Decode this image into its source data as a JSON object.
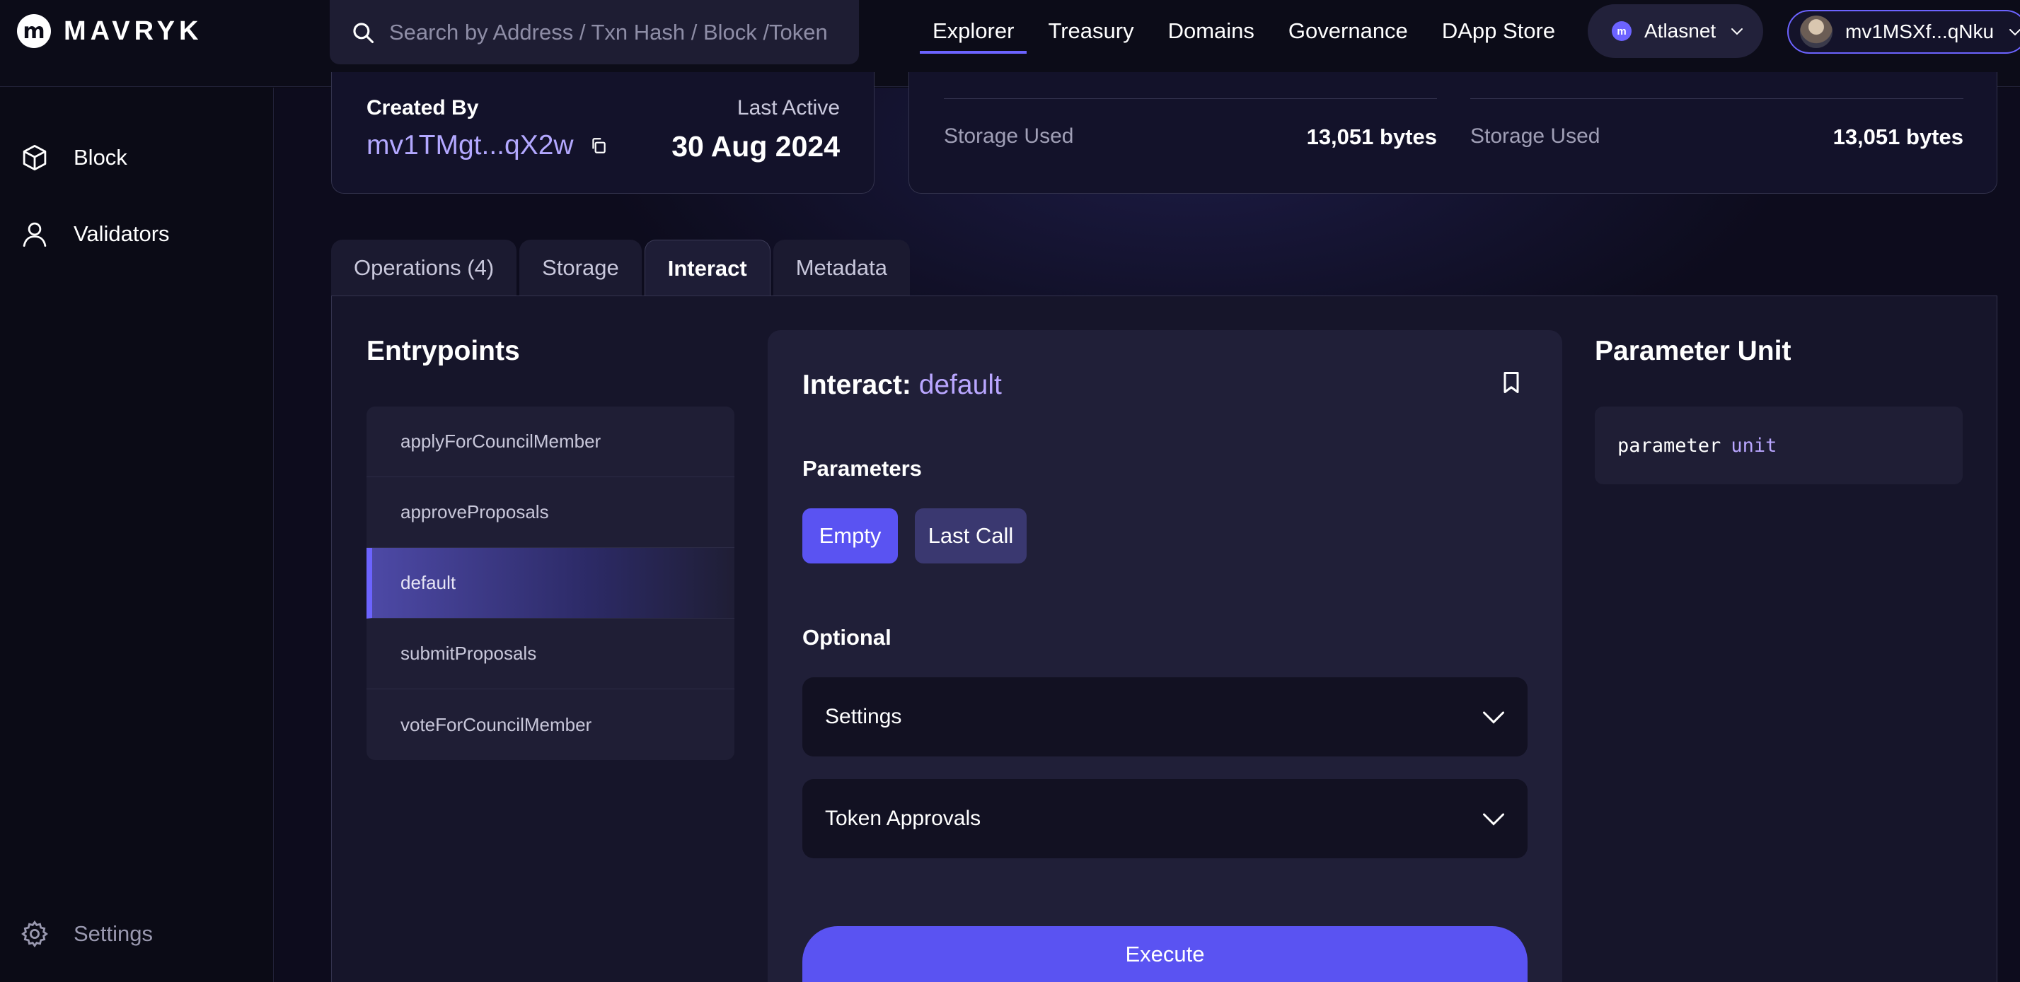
{
  "header": {
    "logo_letter": "m",
    "logo_text": "MAVRYK",
    "search_placeholder": "Search by Address / Txn Hash / Block /Token",
    "nav": [
      {
        "label": "Explorer",
        "active": true
      },
      {
        "label": "Treasury",
        "active": false
      },
      {
        "label": "Domains",
        "active": false
      },
      {
        "label": "Governance",
        "active": false
      },
      {
        "label": "DApp Store",
        "active": false
      }
    ],
    "network": {
      "icon_letter": "m",
      "label": "Atlasnet"
    },
    "wallet": {
      "address": "mv1MSXf...qNku"
    }
  },
  "sidebar": {
    "items": [
      {
        "label": "Block"
      },
      {
        "label": "Validators"
      }
    ],
    "settings_label": "Settings"
  },
  "contract_info": {
    "created_by_label": "Created By",
    "created_by_value": "mv1TMgt...qX2w",
    "last_active_label": "Last Active",
    "last_active_value": "30 Aug 2024",
    "storage": [
      {
        "label": "Storage Used",
        "value": "13,051 bytes"
      },
      {
        "label": "Storage Used",
        "value": "13,051 bytes"
      }
    ]
  },
  "tabs": [
    {
      "label": "Operations (4)",
      "active": false
    },
    {
      "label": "Storage",
      "active": false
    },
    {
      "label": "Interact",
      "active": true
    },
    {
      "label": "Metadata",
      "active": false
    }
  ],
  "entrypoints": {
    "title": "Entrypoints",
    "items": [
      {
        "label": "applyForCouncilMember",
        "active": false
      },
      {
        "label": "approveProposals",
        "active": false
      },
      {
        "label": "default",
        "active": true
      },
      {
        "label": "submitProposals",
        "active": false
      },
      {
        "label": "voteForCouncilMember",
        "active": false
      }
    ]
  },
  "interact": {
    "title_prefix": "Interact:",
    "title_entrypoint": "default",
    "parameters_label": "Parameters",
    "param_options": [
      {
        "label": "Empty",
        "active": true
      },
      {
        "label": "Last Call",
        "active": false
      }
    ],
    "optional_label": "Optional",
    "settings_label": "Settings",
    "token_approvals_label": "Token Approvals",
    "execute_label": "Execute"
  },
  "parameter_unit": {
    "title": "Parameter Unit",
    "keyword": "parameter",
    "type": "unit"
  },
  "colors": {
    "accent": "#6c63ff",
    "button": "#5a53f2",
    "background": "#0b0b16",
    "accent_text": "#b9a6ff"
  }
}
